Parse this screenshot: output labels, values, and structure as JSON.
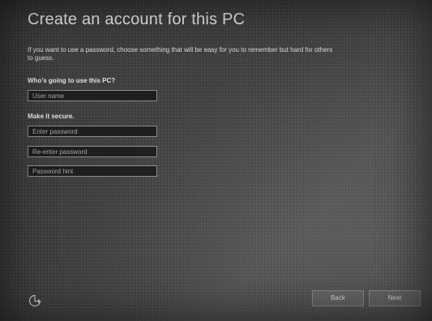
{
  "page": {
    "title": "Create an account for this PC",
    "intro": "If you want to use a password, choose something that will be easy for you to remember but hard for others to guess."
  },
  "user_section": {
    "label": "Who’s going to use this PC?",
    "username_placeholder": "User name"
  },
  "security_section": {
    "label": "Make it secure.",
    "password_placeholder": "Enter password",
    "reenter_placeholder": "Re-enter password",
    "hint_placeholder": "Password hint"
  },
  "footer": {
    "ease_of_access_icon": "ease-of-access-icon",
    "back_label": "Back",
    "next_label": "Next"
  }
}
